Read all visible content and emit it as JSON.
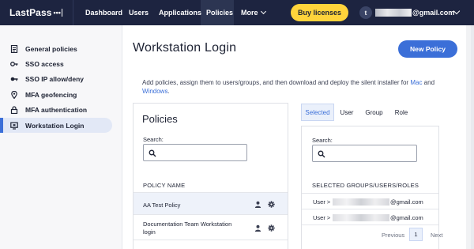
{
  "app": {
    "logo_text": "LastPass",
    "logo_dots": "•••"
  },
  "nav": {
    "items": [
      {
        "label": "Dashboard"
      },
      {
        "label": "Users"
      },
      {
        "label": "Applications"
      },
      {
        "label": "Policies"
      },
      {
        "label": "More"
      }
    ],
    "buy_label": "Buy licenses",
    "avatar_initial": "t",
    "email_suffix": "@gmail.com"
  },
  "sidebar": {
    "items": [
      {
        "label": "General policies",
        "icon": "document-icon"
      },
      {
        "label": "SSO access",
        "icon": "key-icon"
      },
      {
        "label": "SSO IP allow/deny",
        "icon": "ip-key-icon"
      },
      {
        "label": "MFA geofencing",
        "icon": "location-pin-icon"
      },
      {
        "label": "MFA authentication",
        "icon": "lock-icon"
      },
      {
        "label": "Workstation Login",
        "icon": "monitor-icon"
      }
    ],
    "active_index": 5
  },
  "main": {
    "title": "Workstation Login",
    "new_policy_label": "New Policy",
    "description_prefix": "Add policies, assign them to users/groups, and then download and deploy the silent installer for ",
    "link_mac": "Mac",
    "and_text": " and ",
    "link_windows": "Windows",
    "period": "."
  },
  "policies": {
    "title": "Policies",
    "search_label": "Search:",
    "column_header": "POLICY NAME",
    "rows": [
      {
        "name": "AA Test Policy"
      },
      {
        "name_line1": "Documentation Team Workstation",
        "name_line2": "login"
      }
    ]
  },
  "assignments": {
    "tabs": [
      {
        "label": "Selected"
      },
      {
        "label": "User"
      },
      {
        "label": "Group"
      },
      {
        "label": "Role"
      }
    ],
    "active_tab": 0,
    "search_label": "Search:",
    "column_header": "SELECTED GROUPS/USERS/ROLES",
    "rows": [
      {
        "prefix": "User >",
        "domain": "@gmail.com"
      },
      {
        "prefix": "User >",
        "domain": "@gmail.com"
      }
    ],
    "pager": {
      "previous": "Previous",
      "page": "1",
      "next": "Next"
    }
  },
  "colors": {
    "nav_bg": "#1d2440",
    "accent": "#3b6fd8",
    "buy_button": "#ffd43b"
  }
}
